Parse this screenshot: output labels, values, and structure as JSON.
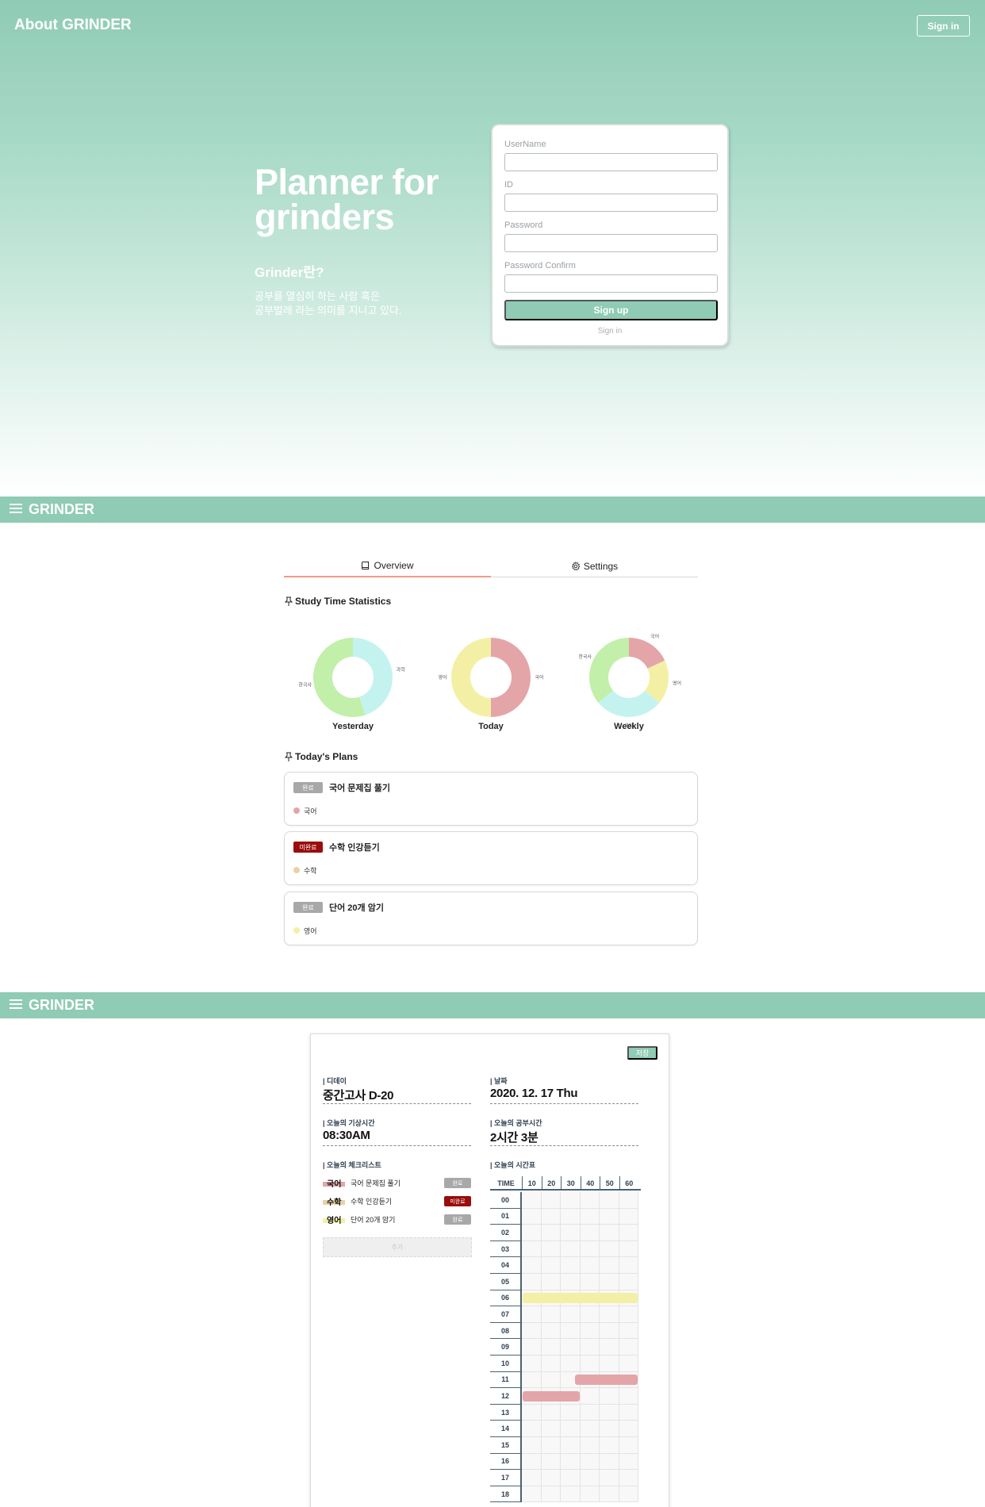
{
  "hero": {
    "brand": "About GRINDER",
    "signin_button": "Sign in",
    "title": "Planner for grinders",
    "subtitle": "Grinder란?",
    "desc_line1": "공부를 열심히 하는 사람 혹은",
    "desc_line2": "공부벌레 라는 의미를 지니고 있다."
  },
  "signup": {
    "fields": [
      {
        "label": "UserName",
        "value": ""
      },
      {
        "label": "ID",
        "value": ""
      },
      {
        "label": "Password",
        "value": ""
      },
      {
        "label": "Password Confirm",
        "value": ""
      }
    ],
    "submit": "Sign up",
    "signin_link": "Sign in"
  },
  "nav": {
    "brand": "GRINDER"
  },
  "overview": {
    "tabs": [
      {
        "label": "Overview",
        "icon": "book-icon",
        "active": true
      },
      {
        "label": "Settings",
        "icon": "gear-icon",
        "active": false
      }
    ],
    "stats_title": "Study Time Statistics",
    "plans_title": "Today's Plans",
    "plans": [
      {
        "status": "완료",
        "done": true,
        "title": "국어 문제집 풀기",
        "subject": "국어",
        "color": "#e4a5a8"
      },
      {
        "status": "미완료",
        "done": false,
        "title": "수학 인강듣기",
        "subject": "수학",
        "color": "#e8d2a6"
      },
      {
        "status": "완료",
        "done": true,
        "title": "단어 20개 암기",
        "subject": "영어",
        "color": "#f3f0a6"
      }
    ]
  },
  "chart_data": [
    {
      "type": "pie",
      "title": "Yesterday",
      "slices": [
        {
          "label": "과학",
          "value": 45,
          "color": "#c4f3ef"
        },
        {
          "label": "한국사",
          "value": 55,
          "color": "#c2efaa"
        }
      ]
    },
    {
      "type": "pie",
      "title": "Today",
      "slices": [
        {
          "label": "국어",
          "value": 50,
          "color": "#e4a5a8"
        },
        {
          "label": "영어",
          "value": 50,
          "color": "#f3f0a6"
        }
      ]
    },
    {
      "type": "pie",
      "title": "Weekly",
      "slices": [
        {
          "label": "국어",
          "value": 18,
          "color": "#e4a5a8"
        },
        {
          "label": "영어",
          "value": 18,
          "color": "#f3f0a6"
        },
        {
          "label": "과학",
          "value": 28,
          "color": "#c4f3ef"
        },
        {
          "label": "한국사",
          "value": 36,
          "color": "#c2efaa"
        }
      ]
    }
  ],
  "planner": {
    "save": "저장",
    "dday_label": "| 디데이",
    "dday_value": "중간고사 D-20",
    "date_label": "| 날짜",
    "date_value": "2020. 12. 17 Thu",
    "wake_label": "| 오늘의 기상시간",
    "wake_value": "08:30AM",
    "study_label": "| 오늘의 공부시간",
    "study_value": "2시간 3분",
    "checklist_label": "| 오늘의 체크리스트",
    "timetable_label": "| 오늘의 시간표",
    "checklist": [
      {
        "subject": "국어",
        "text": "국어 문제집 풀기",
        "status": "완료",
        "done": true,
        "color": "#e4a5a8"
      },
      {
        "subject": "수학",
        "text": "수학 인강듣기",
        "status": "미완료",
        "done": false,
        "color": "#e8d2a6"
      },
      {
        "subject": "영어",
        "text": "단어 20개 암기",
        "status": "완료",
        "done": true,
        "color": "#f3f0a6"
      }
    ],
    "add_button": "추가",
    "timetable": {
      "time_header": "TIME",
      "minute_headers": [
        "10",
        "20",
        "30",
        "40",
        "50",
        "60"
      ],
      "hours": [
        "00",
        "01",
        "02",
        "03",
        "04",
        "05",
        "06",
        "07",
        "08",
        "09",
        "10",
        "11",
        "12",
        "13",
        "14",
        "15",
        "16",
        "17",
        "18"
      ],
      "blocks": [
        {
          "hour": "06",
          "start_min": 0,
          "end_min": 60,
          "color": "#f3f0a6"
        },
        {
          "hour": "11",
          "start_min": 27,
          "end_min": 60,
          "color": "#e4a5a8"
        },
        {
          "hour": "12",
          "start_min": 0,
          "end_min": 30,
          "color": "#e4a5a8"
        }
      ]
    }
  }
}
